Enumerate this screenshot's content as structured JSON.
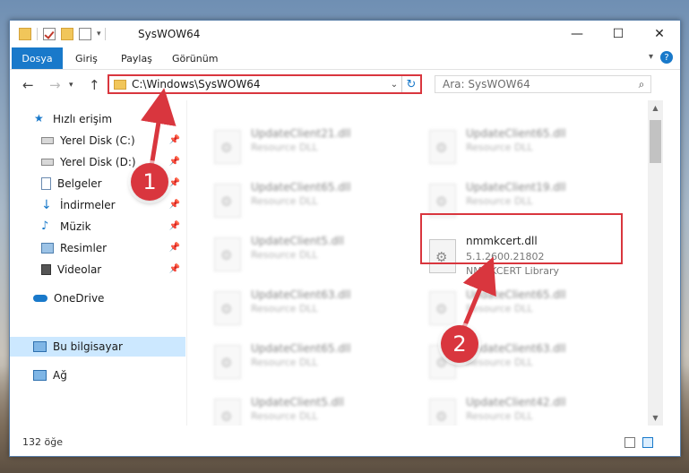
{
  "window": {
    "title": "SysWOW64"
  },
  "ribbon": {
    "file_tab": "Dosya",
    "tabs": [
      "Giriş",
      "Paylaş",
      "Görünüm"
    ],
    "help": "?"
  },
  "nav": {
    "address": "C:\\Windows\\SysWOW64",
    "search_placeholder": "Ara: SysWOW64"
  },
  "sidebar": {
    "items": [
      {
        "label": "Hızlı erişim",
        "icon": "star-icon"
      },
      {
        "label": "Yerel Disk (C:)",
        "icon": "drive-icon",
        "pinned": true
      },
      {
        "label": "Yerel Disk (D:)",
        "icon": "drive-icon",
        "pinned": true
      },
      {
        "label": "Belgeler",
        "icon": "document-icon",
        "pinned": true
      },
      {
        "label": "İndirmeler",
        "icon": "download-icon",
        "pinned": true
      },
      {
        "label": "Müzik",
        "icon": "music-icon",
        "pinned": true
      },
      {
        "label": "Resimler",
        "icon": "pictures-icon",
        "pinned": true
      },
      {
        "label": "Videolar",
        "icon": "video-icon",
        "pinned": true
      },
      {
        "label": "OneDrive",
        "icon": "cloud-icon"
      },
      {
        "label": "Bu bilgisayar",
        "icon": "computer-icon",
        "selected": true
      },
      {
        "label": "Ağ",
        "icon": "network-icon"
      }
    ]
  },
  "files": {
    "left": [
      {
        "name": "UpdateClient21.dll",
        "desc": "Resource DLL"
      },
      {
        "name": "UpdateClient65.dll",
        "desc": "Resource DLL"
      },
      {
        "name": "UpdateClient5.dll",
        "desc": "Resource DLL"
      },
      {
        "name": "UpdateClient63.dll",
        "desc": "Resource DLL"
      },
      {
        "name": "UpdateClient65.dll",
        "desc": "Resource DLL"
      },
      {
        "name": "UpdateClient5.dll",
        "desc": "Resource DLL"
      }
    ],
    "right": [
      {
        "name": "UpdateClient65.dll",
        "desc": "Resource DLL"
      },
      {
        "name": "UpdateClient19.dll",
        "desc": "Resource DLL"
      },
      {
        "name": "UpdateClient65.dll",
        "desc": "Resource DLL"
      },
      {
        "name": "UpdateClient63.dll",
        "desc": "Resource DLL"
      },
      {
        "name": "UpdateClient42.dll",
        "desc": "Resource DLL"
      }
    ],
    "highlighted": {
      "name": "nmmkcert.dll",
      "version": "5.1.2600.21802",
      "desc": "NMMKCERT Library"
    }
  },
  "status": {
    "count": "132 öğe"
  },
  "annotations": {
    "marker1": "1",
    "marker2": "2"
  },
  "colors": {
    "accent": "#1979ca",
    "highlight": "#d9363e",
    "selection": "#cce8ff"
  }
}
